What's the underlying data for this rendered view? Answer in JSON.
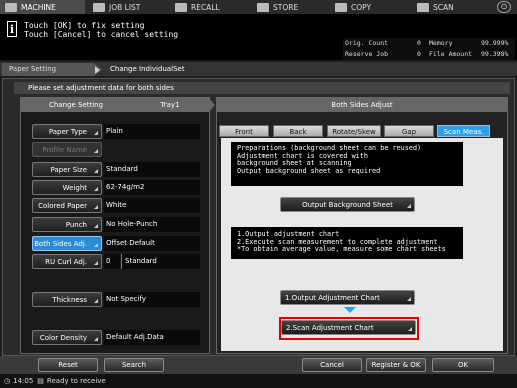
{
  "top_tabs": [
    {
      "label": "MACHINE",
      "icon": "machine-icon"
    },
    {
      "label": "JOB LIST",
      "icon": "job-list-icon"
    },
    {
      "label": "RECALL",
      "icon": "recall-icon"
    },
    {
      "label": "STORE",
      "icon": "store-icon"
    },
    {
      "label": "COPY",
      "icon": "copy-icon"
    },
    {
      "label": "SCAN",
      "icon": "scan-icon"
    }
  ],
  "message": {
    "line1": "Touch [OK] to fix setting",
    "line2": "Touch [Cancel] to cancel setting"
  },
  "status": {
    "orig_count_label": "Orig. Count",
    "orig_count": "0",
    "memory_label": "Memory",
    "memory": "99.999%",
    "reserve_job_label": "Reserve Job",
    "reserve_job": "0",
    "file_amount_label": "File Amount",
    "file_amount": "99.398%"
  },
  "breadcrumb": {
    "item1": "Paper Setting",
    "item2": "Change IndividualSet"
  },
  "instruction": "Please set adjustment data for both sides",
  "left_panel": {
    "header_left": "Change Setting",
    "header_right": "Tray1",
    "rows": [
      {
        "label": "Paper Type",
        "value": "Plain"
      },
      {
        "label": "Profile Name",
        "value": ""
      },
      {
        "label": "Paper Size",
        "value": "Standard"
      },
      {
        "label": "Weight",
        "value": "62-74g/m2"
      },
      {
        "label": "Colored Paper",
        "value": "White"
      },
      {
        "label": "Punch",
        "value": "No Hole-Punch"
      },
      {
        "label": "Both Sides Adj.",
        "value": "Offset Default"
      },
      {
        "label": "RU Curl Adj.",
        "value": "0",
        "value2": "Standard"
      },
      {
        "label": "Thickness",
        "value": "Not Specify"
      },
      {
        "label": "Color Density",
        "value": "Default Adj.Data"
      }
    ]
  },
  "right_panel": {
    "header": "Both Sides Adjust",
    "tabs": [
      "Front",
      "Back",
      "Rotate/Skew",
      "Gap",
      "Scan Meas."
    ],
    "info1": [
      "Preparations (background sheet can be reused)",
      "Adjustment chart is covered with",
      "background sheet at scanning",
      "Output background sheet as required"
    ],
    "btn_output_bg": "Output Background Sheet",
    "info2": [
      "1.Output adjustment chart",
      "2.Execute scan measurement to complete adjustment",
      "*To obtain average value, measure some chart sheets"
    ],
    "btn_output_chart": "1.Output Adjustment Chart",
    "btn_scan_chart": "2.Scan Adjustment Chart"
  },
  "bottom": {
    "reset": "Reset",
    "search": "Search",
    "cancel": "Cancel",
    "register_ok": "Register & OK",
    "ok": "OK"
  },
  "statusbar": {
    "time": "14:05",
    "text": "Ready to receive"
  }
}
